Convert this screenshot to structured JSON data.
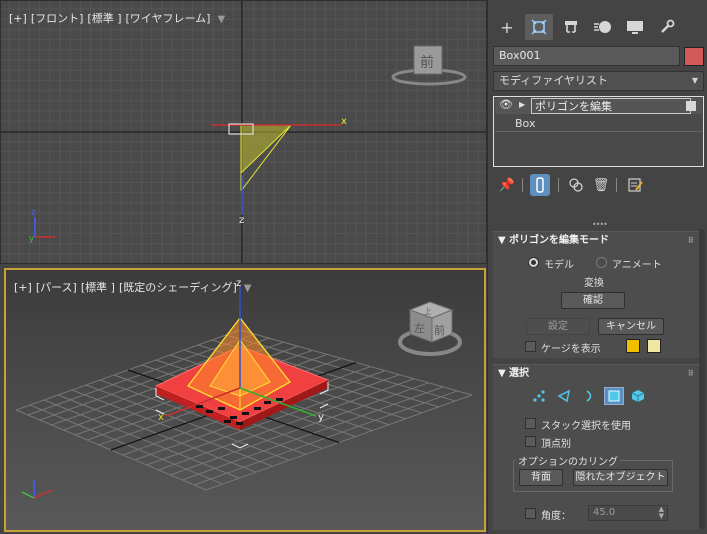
{
  "viewports": {
    "front": {
      "label_plus": "[+]",
      "label_view": "[フロント]",
      "label_mode": "[標準 ]",
      "label_shading": "[ワイヤフレーム]",
      "viewcube_face": "前",
      "axis_x": "x",
      "axis_z": "z",
      "axis_y": "y",
      "tri_z": "z"
    },
    "perspective": {
      "label_plus": "[+]",
      "label_view": "[パース]",
      "label_mode": "[標準 ]",
      "label_shading": "[既定のシェーディング]",
      "viewcube_face": "前",
      "viewcube_side": "左",
      "viewcube_top": "上",
      "axis_x": "x",
      "axis_y": "y",
      "axis_z": "z"
    }
  },
  "command_panel": {
    "tabs": [
      {
        "icon": "plus-icon",
        "glyph": "+"
      },
      {
        "icon": "modify-icon",
        "glyph": "⧉"
      },
      {
        "icon": "hierarchy-icon",
        "glyph": "⊤"
      },
      {
        "icon": "motion-icon",
        "glyph": "◐"
      },
      {
        "icon": "display-icon",
        "glyph": "▭"
      },
      {
        "icon": "utilities-icon",
        "glyph": "🔧"
      }
    ],
    "object_name": "Box001",
    "object_color": "#d25a5a",
    "modifier_list": "モディファイヤリスト",
    "stack": {
      "modifier": "ポリゴンを編集",
      "base": "Box"
    },
    "edit_poly_mode": {
      "title": "ポリゴンを編集モード",
      "model": "モデル",
      "animate": "アニメート",
      "transform": "変換",
      "commit": "確認",
      "settings": "設定",
      "cancel": "キャンセル",
      "show_cage": "ケージを表示",
      "cage_color_1": "#f0c000",
      "cage_color_2": "#f0e8a0"
    },
    "selection": {
      "title": "選択",
      "use_stack_selection": "スタック選択を使用",
      "by_vertex": "頂点別",
      "culling_group": "オプションのカリング",
      "backfacing": "背面",
      "occluded": "隠れたオブジェクト",
      "angle_label": "角度：",
      "angle_value": "45.0"
    }
  }
}
